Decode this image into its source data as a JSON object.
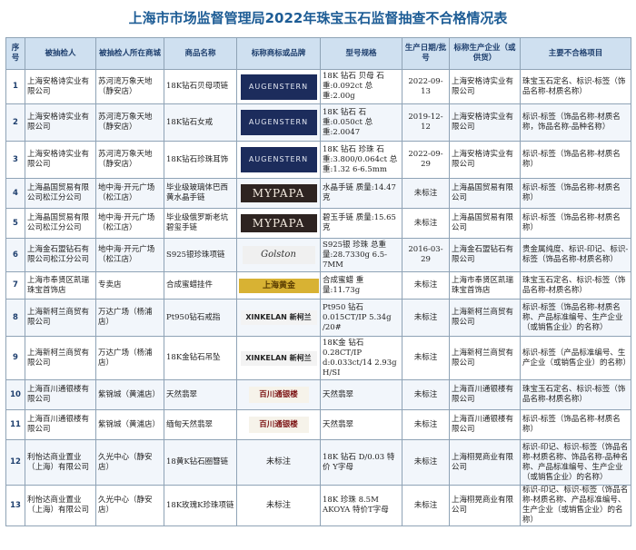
{
  "title": "上海市市场监督管理局2022年珠宝玉石监督抽查不合格情况表",
  "headers": [
    "序号",
    "被抽检人",
    "被抽检人所在商城",
    "商品名称",
    "标称商标或品牌",
    "型号规格",
    "生产日期/批号",
    "标称生产企业（或供货）",
    "主要不合格项目"
  ],
  "rows": [
    {
      "seq": "1",
      "inspected": "上海安格诗实业有限公司",
      "mall": "苏河湾万象天地（静安店）",
      "product": "18K钻石贝母项链",
      "brand": "AUGENSTERN",
      "brand_style": "aug",
      "spec": "18K 钻石 贝母 石重:0.092ct 总重:2.00g",
      "date": "2022-09-13",
      "producer": "上海安格诗实业有限公司",
      "issue": "珠宝玉石定名、标识-标签（饰品名称-材质名称）"
    },
    {
      "seq": "2",
      "inspected": "上海安格诗实业有限公司",
      "mall": "苏河湾万象天地（静安店）",
      "product": "18K钻石女戒",
      "brand": "AUGENSTERN",
      "brand_style": "aug",
      "spec": "18K 钻石 石重:0.050ct 总重:2.0047",
      "date": "2019-12-12",
      "producer": "上海安格诗实业有限公司",
      "issue": "标识-标签（饰品名称-材质名称，饰品名称-品种名称）"
    },
    {
      "seq": "3",
      "inspected": "上海安格诗实业有限公司",
      "mall": "苏河湾万象天地（静安店）",
      "product": "18K钻石珍珠耳饰",
      "brand": "AUGENSTERN",
      "brand_style": "aug",
      "spec": "18K 钻石 珍珠 石重:3.800/0.064ct 总重:1.32 6-6.5mm",
      "date": "2022-09-29",
      "producer": "上海安格诗实业有限公司",
      "issue": "标识-标签（饰品名称-材质名称）"
    },
    {
      "seq": "4",
      "inspected": "上海晶国贸易有限公司松江分公司",
      "mall": "地中海·开元广场（松江店）",
      "product": "毕业级玻璃体巴西黄水晶手链",
      "brand": "MYPAPA",
      "brand_style": "myp",
      "spec": "水晶手链 质量:14.47克",
      "date": "未标注",
      "producer": "上海晶国贸易有限公司",
      "issue": "标识-标签（饰品名称-材质名称）"
    },
    {
      "seq": "5",
      "inspected": "上海晶国贸易有限公司松江分公司",
      "mall": "地中海·开元广场（松江店）",
      "product": "毕业级俄罗斯老坑碧玺手链",
      "brand": "MYPAPA",
      "brand_style": "myp",
      "spec": "碧玉手链 质量:15.65克",
      "date": "未标注",
      "producer": "上海晶国贸易有限公司",
      "issue": "标识-标签（饰品名称-材质名称）"
    },
    {
      "seq": "6",
      "inspected": "上海金石盟钻石有限公司松江分公司",
      "mall": "地中海·开元广场（松江店）",
      "product": "S925银珍珠项链",
      "brand": "Golston",
      "brand_style": "gol",
      "spec": "S925银 珍珠 总重量:28.7330g 6.5-7MM",
      "date": "2016-03-29",
      "producer": "上海金石盟钻石有限公司",
      "issue": "贵金属纯度、标识-印记、标识-标签（饰品名称-材质名称）"
    },
    {
      "seq": "7",
      "inspected": "上海市奉贤区凯瑞珠宝首饰店",
      "mall": "专卖店",
      "product": "合成蜜蜡挂件",
      "brand": "上海黄金",
      "brand_style": "shj",
      "spec": "合成蜜蜡 重量:11.73g",
      "date": "未标注",
      "producer": "上海市奉贤区凯瑞珠宝首饰店",
      "issue": "珠宝玉石定名、标识-标签（饰品名称-材质名称）"
    },
    {
      "seq": "8",
      "inspected": "上海新柯兰商贸有限公司",
      "mall": "万达广场（杨浦店）",
      "product": "Pt950钻石戒指",
      "brand": "XINKELAN 新柯兰",
      "brand_style": "xin",
      "spec": "Pt950 钻石 0.015CT/IP 5.34g /20#",
      "date": "未标注",
      "producer": "上海新柯兰商贸有限公司",
      "issue": "标识-标签（饰品名称-材质名称、产品标准编号、生产企业（或销售企业）的名称）"
    },
    {
      "seq": "9",
      "inspected": "上海新柯兰商贸有限公司",
      "mall": "万达广场（杨浦店）",
      "product": "18K金钻石吊坠",
      "brand": "XINKELAN 新柯兰",
      "brand_style": "xin",
      "spec": "18K金 钻石 0.28CT/IP d:0.033ct/14 2.93g H/SI",
      "date": "未标注",
      "producer": "上海新柯兰商贸有限公司",
      "issue": "标识-标签（产品标准编号、生产企业（或销售企业）的名称）"
    },
    {
      "seq": "10",
      "inspected": "上海百川通银楼有限公司",
      "mall": "紫锦城（黄浦店）",
      "product": "天然翡翠",
      "brand": "百川通银楼",
      "brand_style": "bct",
      "spec": "天然翡翠",
      "date": "未标注",
      "producer": "上海百川通银楼有限公司",
      "issue": "珠宝玉石定名、标识-标签（饰品名称-材质名称）"
    },
    {
      "seq": "11",
      "inspected": "上海百川通银楼有限公司",
      "mall": "紫锦城（黄浦店）",
      "product": "缅甸天然翡翠",
      "brand": "百川通银楼",
      "brand_style": "bct",
      "spec": "天然翡翠",
      "date": "未标注",
      "producer": "上海百川通银楼有限公司",
      "issue": "标识-标签（饰品名称-材质名称）"
    },
    {
      "seq": "12",
      "inspected": "利怡达商业置业（上海）有限公司",
      "mall": "久光中心（静安店）",
      "product": "18黄K钻石圈簪链",
      "brand": "未标注",
      "brand_style": "plain",
      "spec": "18K 钻石 D/0.03 特价 Y字母",
      "date": "未标注",
      "producer": "上海栩晃商业有限公司",
      "issue": "标识-印记、标识-标签（饰品名称-材质名称、饰品名称-品种名称、产品标准编号、生产企业（或销售企业）的名称）"
    },
    {
      "seq": "13",
      "inspected": "利怡达商业置业（上海）有限公司",
      "mall": "久光中心（静安店）",
      "product": "18K玫瑰K珍珠项链",
      "brand": "未标注",
      "brand_style": "plain",
      "spec": "18K 珍珠 8.5M AKOYA 特价T字母",
      "date": "未标注",
      "producer": "上海栩晃商业有限公司",
      "issue": "标识-印记、标识-标签（饰品名称-材质名称、产品标准编号、生产企业（或销售企业）的名称）"
    }
  ]
}
